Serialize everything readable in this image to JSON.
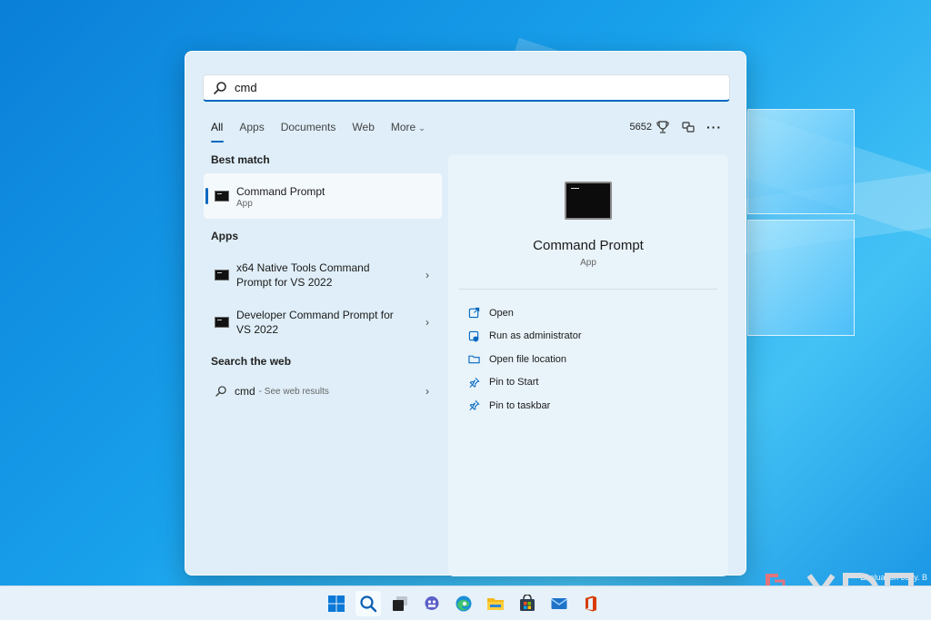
{
  "search": {
    "query": "cmd"
  },
  "tabs": [
    {
      "label": "All",
      "active": true
    },
    {
      "label": "Apps"
    },
    {
      "label": "Documents"
    },
    {
      "label": "Web"
    },
    {
      "label": "More"
    }
  ],
  "tools": {
    "points": "5652"
  },
  "sections": {
    "best_match": "Best match",
    "apps": "Apps",
    "web": "Search the web"
  },
  "best_match": {
    "title": "Command Prompt",
    "subtitle": "App"
  },
  "apps": [
    {
      "line1": "x64 Native Tools Command",
      "line2": "Prompt for VS 2022"
    },
    {
      "line1": "Developer Command Prompt for",
      "line2": "VS 2022"
    }
  ],
  "web_result": {
    "query": "cmd",
    "hint": "- See web results"
  },
  "detail": {
    "title": "Command Prompt",
    "subtitle": "App",
    "actions": [
      {
        "label": "Open",
        "icon": "open-icon"
      },
      {
        "label": "Run as administrator",
        "icon": "shield-icon"
      },
      {
        "label": "Open file location",
        "icon": "folder-icon"
      },
      {
        "label": "Pin to Start",
        "icon": "pin-icon"
      },
      {
        "label": "Pin to taskbar",
        "icon": "pin-icon"
      }
    ]
  },
  "taskbar": {
    "icons": [
      "start-icon",
      "search-icon",
      "task-view-icon",
      "teams-chat-icon",
      "edge-icon",
      "file-explorer-icon",
      "store-icon",
      "mail-icon",
      "office-icon"
    ]
  },
  "watermark": {
    "text": "Evaluation copy. B",
    "brand": "XDA"
  },
  "colors": {
    "accent": "#0067c0",
    "flyout_bg": "#dfeef8"
  }
}
